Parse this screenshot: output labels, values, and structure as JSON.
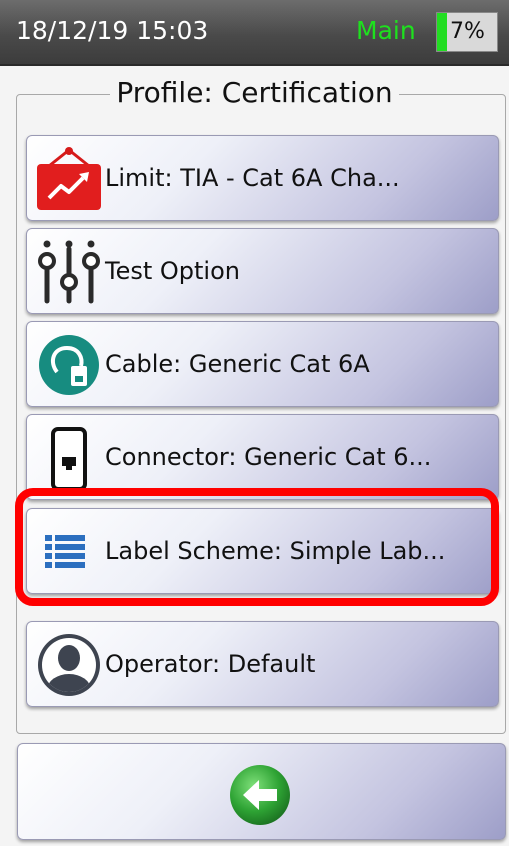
{
  "status_bar": {
    "datetime": "18/12/19 15:03",
    "mode": "Main",
    "battery_percent_label": "7%",
    "battery_level": 0.07,
    "mode_color": "#1ee11e"
  },
  "profile": {
    "title": "Profile: Certification",
    "items": [
      {
        "label": "Limit: TIA - Cat 6A Cha...",
        "icon": "limit-chart-icon"
      },
      {
        "label": "Test Option",
        "icon": "sliders-icon"
      },
      {
        "label": "Cable: Generic Cat 6A",
        "icon": "cable-icon"
      },
      {
        "label": "Connector: Generic Cat 6...",
        "icon": "connector-icon"
      },
      {
        "label": "Label Scheme: Simple Lab...",
        "icon": "list-icon"
      },
      {
        "label": "Operator: Default",
        "icon": "operator-avatar-icon"
      }
    ]
  },
  "back_button": {
    "icon": "back-arrow-icon"
  },
  "highlight_color": "#ff0000"
}
